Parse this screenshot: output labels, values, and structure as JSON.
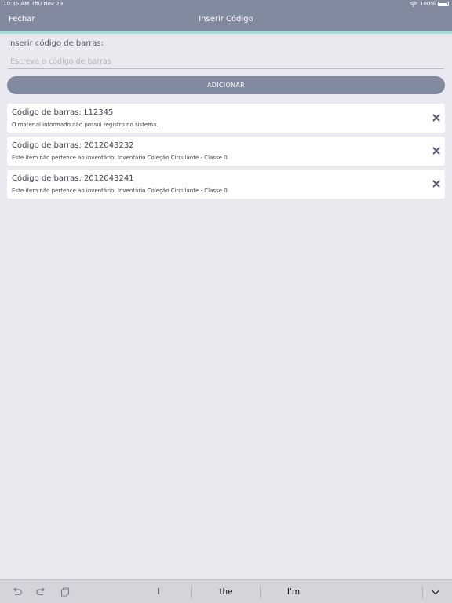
{
  "status_bar": {
    "time": "10:36 AM",
    "date": "Thu Nov 29",
    "battery": "100%"
  },
  "nav": {
    "close_label": "Fechar",
    "title": "Inserir Código"
  },
  "form": {
    "label": "Inserir código de barras:",
    "placeholder": "Escreva o código de barras",
    "value": "",
    "add_label": "ADICIONAR"
  },
  "results": [
    {
      "title": "Código de barras: L12345",
      "message": "O material informado não possui registro no sistema."
    },
    {
      "title": "Código de barras: 2012043232",
      "message": "Este item não pertence ao inventário: Inventário Coleção Circulante - Classe 0"
    },
    {
      "title": "Código de barras: 2012043241",
      "message": "Este item não pertence ao inventário: Inventário Coleção Circulante - Classe 0"
    }
  ],
  "keyboard_bar": {
    "suggestions": [
      "I",
      "the",
      "I'm"
    ],
    "icons": [
      "undo-icon",
      "redo-icon",
      "paste-icon",
      "dismiss-keyboard-icon"
    ]
  },
  "colors": {
    "header": "#818a9e",
    "accent": "#9fe0da",
    "background": "#e9e9ef",
    "card": "#ffffff"
  }
}
